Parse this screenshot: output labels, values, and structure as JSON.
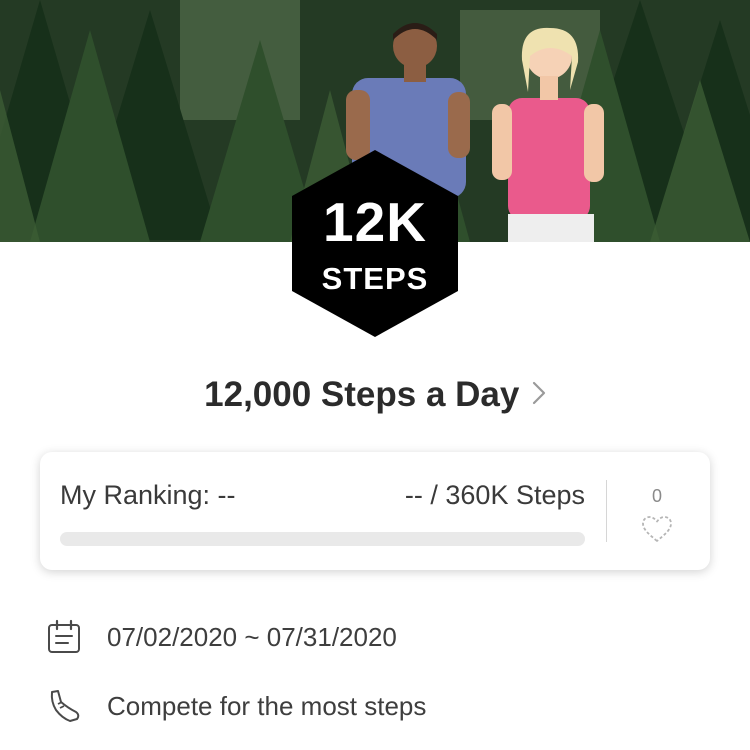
{
  "hero": {
    "image": "two-runners-jogging-in-forest",
    "badge": {
      "value": "12K",
      "unit": "STEPS",
      "color": "#000000"
    }
  },
  "challenge": {
    "title": "12,000 Steps a Day",
    "chevron_icon": "chevron-right-icon"
  },
  "ranking": {
    "label": "My Ranking: --",
    "steps_text": "-- / 360K Steps",
    "progress": 0,
    "likes": "0",
    "like_icon": "heart-outline-icon"
  },
  "details": {
    "date_icon": "calendar-icon",
    "date_range": "07/02/2020 ~ 07/31/2020",
    "goal_icon": "shoe-icon",
    "goal": "Compete for the most steps"
  }
}
